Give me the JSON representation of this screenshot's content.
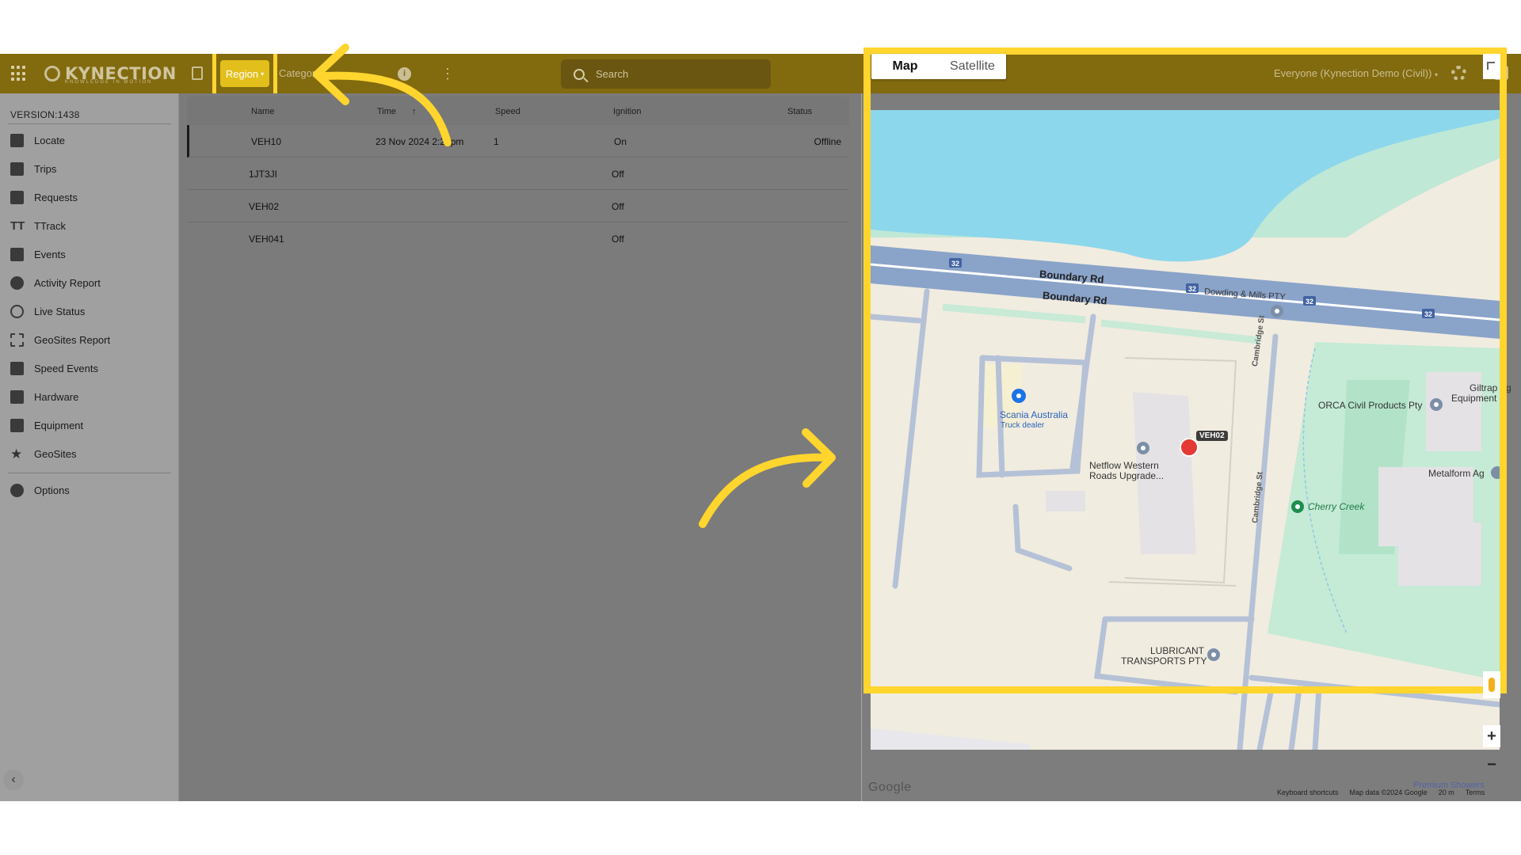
{
  "header": {
    "logo_text": "KYNECTION",
    "logo_tagline": "KNOWLEDGE IN MOTION",
    "region_label": "Region",
    "category_label": "Categor",
    "search_placeholder": "Search",
    "org_selector": "Everyone (Kynection Demo (Civil))",
    "info_glyph": "i",
    "kebab_glyph": "⋮",
    "caret_glyph": "▾"
  },
  "sidebar": {
    "version": "VERSION:1438",
    "items": [
      {
        "label": "Locate",
        "icon": "map-icon"
      },
      {
        "label": "Trips",
        "icon": "route-icon"
      },
      {
        "label": "Requests",
        "icon": "question-icon"
      },
      {
        "label": "TTrack",
        "icon": "ttrack-icon",
        "glyph": "TT"
      },
      {
        "label": "Events",
        "icon": "events-icon"
      },
      {
        "label": "Activity Report",
        "icon": "person-pin-icon"
      },
      {
        "label": "Live Status",
        "icon": "check-circle-icon"
      },
      {
        "label": "GeoSites Report",
        "icon": "dashed-square-icon"
      },
      {
        "label": "Speed Events",
        "icon": "road-icon"
      },
      {
        "label": "Hardware",
        "icon": "wrench-icon"
      },
      {
        "label": "Equipment",
        "icon": "truck-icon"
      },
      {
        "label": "GeoSites",
        "icon": "star-icon",
        "glyph": "★"
      }
    ],
    "options_label": "Options",
    "collapse_glyph": "‹"
  },
  "table": {
    "columns": [
      "Name",
      "Time",
      "Speed",
      "Ignition",
      "Status"
    ],
    "sort_glyph": "↑",
    "rows": [
      {
        "name": "VEH10",
        "time": "23 Nov 2024 2:24pm",
        "speed": "1",
        "ignition": "On",
        "status": "Offline"
      },
      {
        "name": "1JT3JI",
        "time": "",
        "speed": "",
        "ignition": "Off",
        "status": ""
      },
      {
        "name": "VEH02",
        "time": "",
        "speed": "",
        "ignition": "Off",
        "status": ""
      },
      {
        "name": "VEH041",
        "time": "",
        "speed": "",
        "ignition": "Off",
        "status": ""
      }
    ]
  },
  "map": {
    "map_type_map": "Map",
    "map_type_satellite": "Satellite",
    "zoom_in": "+",
    "zoom_out": "−",
    "google": "Google",
    "footer": [
      "Keyboard shortcuts",
      "Map data ©2024 Google",
      "20 m",
      "Terms"
    ],
    "premium": "Premium Showers",
    "labels": {
      "road_upper": "Boundary Rd",
      "road_lower": "Boundary Rd",
      "route_number": "32",
      "dowding": "Dowding & Mills PTY",
      "scania": "Scania Australia",
      "scania_sub": "Truck dealer",
      "netflow_1": "Netflow Western",
      "netflow_2": "Roads Upgrade...",
      "orca": "ORCA Civil Products Pty",
      "giltrap_1": "Giltrap Ag",
      "giltrap_2": "Equipment",
      "metalform": "Metalform Ag",
      "cherry_creek": "Cherry Creek",
      "cambridge_upper": "Cambridge St",
      "cambridge_lower": "Cambridge St",
      "lubricant_1": "LUBRICANT",
      "lubricant_2": "TRANSPORTS PTY",
      "vehicle_marker": "VEH02"
    }
  },
  "colors": {
    "header_bg": "#826a0e",
    "highlight": "#ffd52e",
    "region_btn": "#e3bf1c",
    "vehicle_marker": "#e53935"
  }
}
